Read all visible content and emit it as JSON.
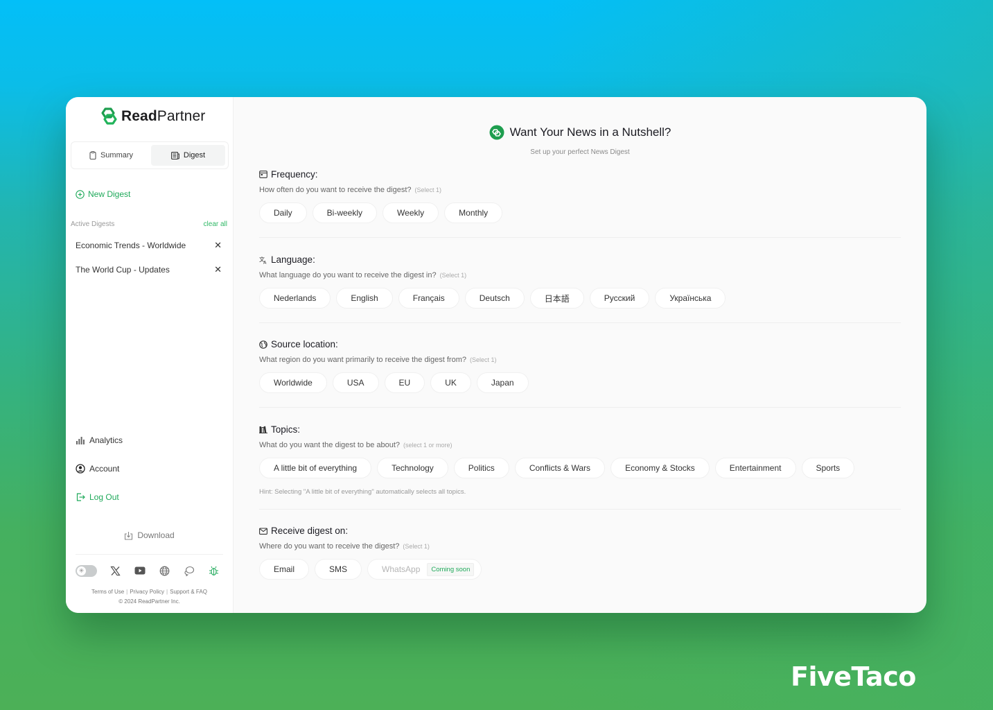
{
  "app": {
    "brand_bold": "Read",
    "brand_light": "Partner",
    "accent_color": "#1fa95a"
  },
  "sidebar": {
    "tabs": [
      {
        "label": "Summary",
        "icon": "clipboard-icon",
        "active": false
      },
      {
        "label": "Digest",
        "icon": "newspaper-icon",
        "active": true
      }
    ],
    "new_digest_label": "New Digest",
    "active_digests_label": "Active Digests",
    "clear_all_label": "clear all",
    "active_digests": [
      {
        "label": "Economic Trends - Worldwide"
      },
      {
        "label": "The World Cup - Updates"
      }
    ],
    "nav": [
      {
        "label": "Analytics",
        "icon": "bar-chart-icon"
      },
      {
        "label": "Account",
        "icon": "user-circle-icon"
      },
      {
        "label": "Log Out",
        "icon": "logout-icon"
      }
    ],
    "download_label": "Download",
    "social_icons": [
      "theme-toggle",
      "x-icon",
      "youtube-icon",
      "globe-icon",
      "chat-icon",
      "bug-icon"
    ],
    "legal": {
      "terms": "Terms of Use",
      "privacy": "Privacy Policy",
      "support": "Support & FAQ",
      "copyright": "© 2024 ReadPartner Inc."
    }
  },
  "main": {
    "title": "Want Your News in a Nutshell?",
    "subtitle": "Set up your perfect News Digest",
    "sections": {
      "frequency": {
        "title": "Frequency:",
        "question": "How often do you want to receive the digest?",
        "hint": "(Select 1)",
        "options": [
          "Daily",
          "Bi-weekly",
          "Weekly",
          "Monthly"
        ]
      },
      "language": {
        "title": "Language:",
        "question": "What language do you want to receive the digest in?",
        "hint": "(Select 1)",
        "options": [
          "Nederlands",
          "English",
          "Français",
          "Deutsch",
          "日本語",
          "Русский",
          "Українська"
        ]
      },
      "source": {
        "title": "Source location:",
        "question": "What region do you want primarily to receive the digest from?",
        "hint": "(Select 1)",
        "options": [
          "Worldwide",
          "USA",
          "EU",
          "UK",
          "Japan"
        ]
      },
      "topics": {
        "title": "Topics:",
        "question": "What do you want the digest to be about?",
        "hint": "(select 1 or more)",
        "options": [
          "A little bit of everything",
          "Technology",
          "Politics",
          "Conflicts & Wars",
          "Economy & Stocks",
          "Entertainment",
          "Sports"
        ],
        "footnote": "Hint: Selecting \"A little bit of everything\" automatically selects all topics."
      },
      "receive": {
        "title": "Receive digest on:",
        "question": "Where do you want to receive the digest?",
        "hint": "(Select 1)",
        "options": [
          "Email",
          "SMS"
        ],
        "disabled_option": "WhatsApp",
        "disabled_badge": "Coming soon"
      }
    }
  },
  "watermark": "FiveTaco"
}
